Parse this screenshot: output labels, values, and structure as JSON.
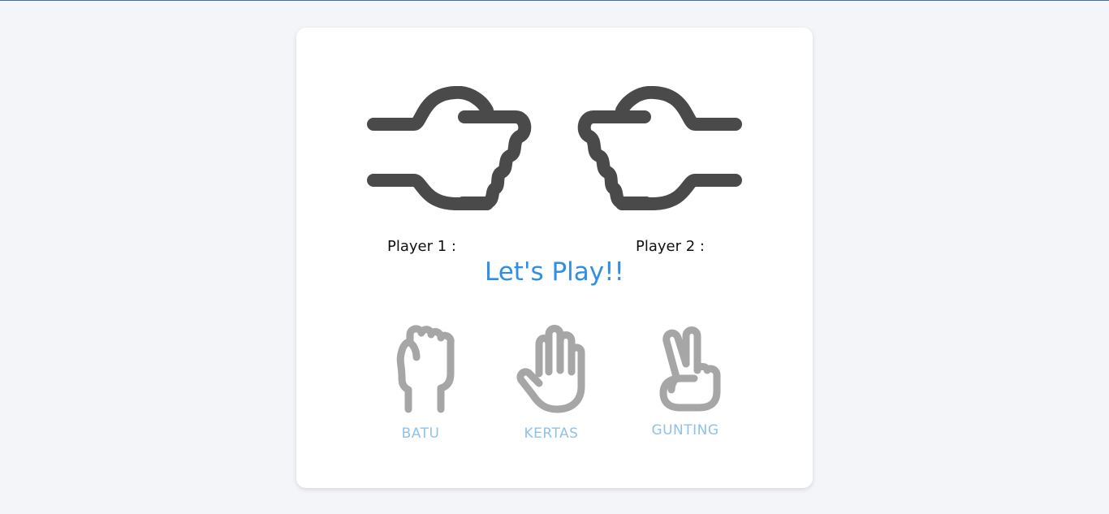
{
  "game": {
    "player1_label": "Player 1 :",
    "player2_label": "Player 2 :",
    "status_text": "Let's Play!!",
    "choices": [
      {
        "label": "BATU",
        "icon": "rock-hand-icon"
      },
      {
        "label": "KERTAS",
        "icon": "paper-hand-icon"
      },
      {
        "label": "GUNTING",
        "icon": "scissors-hand-icon"
      }
    ]
  },
  "colors": {
    "accent": "#2e8ee8",
    "choice_label": "#8fc2ea",
    "fist": "#4a4a4a",
    "choice_icon": "#a6a6a6",
    "page_bg": "#f3f5f9",
    "card_bg": "#ffffff"
  }
}
